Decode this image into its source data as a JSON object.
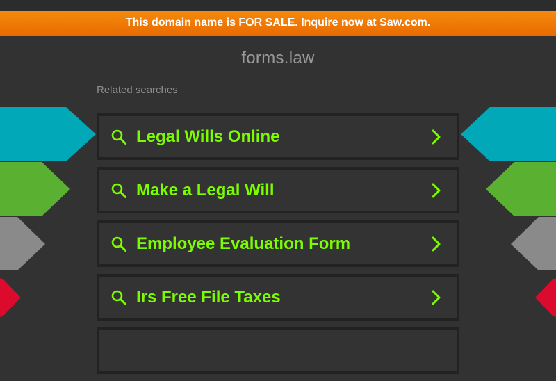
{
  "banner": {
    "text": "This domain name is FOR SALE. Inquire now at Saw.com."
  },
  "domain": {
    "name": "forms.law"
  },
  "related": {
    "label": "Related searches",
    "items": [
      {
        "label": "Legal Wills Online"
      },
      {
        "label": "Make a Legal Will"
      },
      {
        "label": "Employee Evaluation Form"
      },
      {
        "label": "Irs Free File Taxes"
      }
    ]
  },
  "colors": {
    "background": "#323232",
    "banner": "#f07d05",
    "link_text": "#7cfc00",
    "decor_teal": "#00a8b8",
    "decor_green": "#5ab030",
    "decor_gray": "#8a8a8a",
    "decor_red": "#dc0a2c"
  },
  "icons": {
    "search": "search-icon",
    "chevron": "chevron-right-icon"
  }
}
